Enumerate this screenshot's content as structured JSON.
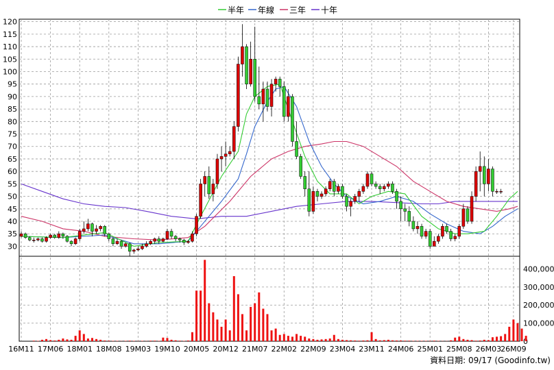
{
  "chart_data": {
    "type": "candlestick",
    "legend": [
      {
        "label": "半年",
        "color": "#33cc33"
      },
      {
        "label": "年線",
        "color": "#3366cc"
      },
      {
        "label": "三年",
        "color": "#cc3366"
      },
      {
        "label": "十年",
        "color": "#6633cc"
      }
    ],
    "price_ticks": [
      30,
      35,
      40,
      45,
      50,
      55,
      60,
      65,
      70,
      75,
      80,
      85,
      90,
      95,
      100,
      105,
      110,
      115,
      120
    ],
    "price_ylim": [
      26,
      121
    ],
    "volume_ticks": [
      {
        "value": 0,
        "label": "0"
      },
      {
        "value": 100000,
        "label": "100,000"
      },
      {
        "value": 200000,
        "label": "200,000"
      },
      {
        "value": 300000,
        "label": "300,000"
      },
      {
        "value": 400000,
        "label": "400,000"
      }
    ],
    "volume_ylim": [
      0,
      470000
    ],
    "x_ticks": [
      {
        "i": 0,
        "label": "16M11"
      },
      {
        "i": 7,
        "label": "17M06"
      },
      {
        "i": 14,
        "label": "18M01"
      },
      {
        "i": 21,
        "label": "18M08"
      },
      {
        "i": 28,
        "label": "19M03"
      },
      {
        "i": 35,
        "label": "19M10"
      },
      {
        "i": 42,
        "label": "20M05"
      },
      {
        "i": 49,
        "label": "20M12"
      },
      {
        "i": 56,
        "label": "21M07"
      },
      {
        "i": 63,
        "label": "22M02"
      },
      {
        "i": 70,
        "label": "22M09"
      },
      {
        "i": 77,
        "label": "23M04"
      },
      {
        "i": 84,
        "label": "23M11"
      },
      {
        "i": 91,
        "label": "24M06"
      },
      {
        "i": 98,
        "label": "25M01"
      },
      {
        "i": 105,
        "label": "25M08"
      },
      {
        "i": 112,
        "label": "26M03"
      },
      {
        "i": 118,
        "label": "26M09"
      }
    ],
    "x_count": 120,
    "candles": [
      [
        34,
        35,
        36,
        33.5
      ],
      [
        35,
        33.5,
        35.5,
        33
      ],
      [
        33.5,
        32.5,
        34,
        32
      ],
      [
        32.5,
        32.5,
        33.5,
        31.5
      ],
      [
        32.5,
        33,
        33.5,
        32
      ],
      [
        33,
        32,
        33.5,
        31.5
      ],
      [
        32,
        33.5,
        34,
        31.5
      ],
      [
        33.5,
        34.5,
        35,
        33
      ],
      [
        34.5,
        33.5,
        35,
        33
      ],
      [
        33.5,
        35,
        36,
        33
      ],
      [
        35,
        34,
        35.5,
        33
      ],
      [
        34,
        32,
        34.5,
        31.5
      ],
      [
        32,
        31,
        32.5,
        30
      ],
      [
        31,
        33,
        33.5,
        30.5
      ],
      [
        33,
        36,
        37,
        32
      ],
      [
        36,
        37,
        40,
        35
      ],
      [
        37,
        39,
        41,
        36
      ],
      [
        39,
        36,
        39.5,
        34
      ],
      [
        36,
        37,
        38.5,
        35
      ],
      [
        37,
        38,
        38.5,
        36
      ],
      [
        38,
        35,
        38.5,
        34
      ],
      [
        35,
        33,
        35.5,
        32
      ],
      [
        33,
        31,
        33.5,
        30
      ],
      [
        31,
        32,
        33,
        30.5
      ],
      [
        32,
        30,
        32.5,
        29
      ],
      [
        30,
        31,
        31.5,
        29.5
      ],
      [
        31,
        28,
        31.5,
        26
      ],
      [
        28,
        28.5,
        29,
        27
      ],
      [
        28.5,
        29,
        30,
        28
      ],
      [
        29,
        30,
        31,
        28.5
      ],
      [
        30,
        31,
        32,
        29.5
      ],
      [
        31,
        32,
        32.5,
        30.5
      ],
      [
        32,
        33,
        33.5,
        31
      ],
      [
        33,
        32,
        34,
        31
      ],
      [
        32,
        33,
        33.5,
        31.5
      ],
      [
        33,
        36,
        37,
        32.5
      ],
      [
        36,
        34,
        37,
        33
      ],
      [
        34,
        33,
        34.5,
        32
      ],
      [
        33,
        32.5,
        33.5,
        31.5
      ],
      [
        32.5,
        31.5,
        33,
        30.5
      ],
      [
        31.5,
        32,
        32.5,
        31
      ],
      [
        32,
        35,
        36,
        31.5
      ],
      [
        35,
        42,
        43,
        34
      ],
      [
        42,
        55,
        57,
        41
      ],
      [
        55,
        58,
        60,
        50
      ],
      [
        58,
        51,
        62,
        49
      ],
      [
        51,
        55,
        57,
        48
      ],
      [
        55,
        65,
        67,
        53
      ],
      [
        65,
        66,
        70,
        60
      ],
      [
        66,
        67,
        72,
        62
      ],
      [
        67,
        68,
        70,
        66
      ],
      [
        68,
        78,
        80,
        65
      ],
      [
        78,
        103,
        106,
        76
      ],
      [
        103,
        110,
        119,
        98
      ],
      [
        110,
        95,
        111,
        93
      ],
      [
        95,
        105,
        112,
        94
      ],
      [
        105,
        90,
        118,
        88
      ],
      [
        90,
        87,
        102,
        85
      ],
      [
        87,
        93,
        96,
        80
      ],
      [
        93,
        86,
        96,
        84
      ],
      [
        86,
        95,
        97,
        82
      ],
      [
        95,
        97,
        98,
        92
      ],
      [
        97,
        94,
        98,
        90
      ],
      [
        94,
        82,
        96,
        80
      ],
      [
        82,
        90,
        93,
        80
      ],
      [
        90,
        72,
        91,
        70
      ],
      [
        72,
        66,
        80,
        65
      ],
      [
        66,
        58,
        67,
        57
      ],
      [
        58,
        53,
        60,
        50
      ],
      [
        53,
        44,
        60,
        42
      ],
      [
        44,
        52,
        54,
        43
      ],
      [
        52,
        50,
        53,
        48
      ],
      [
        50,
        51,
        52,
        49
      ],
      [
        51,
        53,
        54,
        50
      ],
      [
        53,
        56,
        57,
        52
      ],
      [
        56,
        52,
        57,
        50
      ],
      [
        52,
        54,
        55,
        51
      ],
      [
        54,
        50,
        55,
        49
      ],
      [
        50,
        46,
        51,
        44
      ],
      [
        46,
        48,
        49,
        42
      ],
      [
        48,
        50,
        51,
        47
      ],
      [
        50,
        52,
        53,
        48
      ],
      [
        52,
        54,
        55,
        51
      ],
      [
        54,
        59,
        60,
        53
      ],
      [
        59,
        55,
        60,
        54
      ],
      [
        55,
        54,
        56,
        53
      ],
      [
        54,
        53,
        55,
        51
      ],
      [
        53,
        54,
        55,
        52
      ],
      [
        54,
        55,
        56,
        53
      ],
      [
        55,
        52,
        56,
        51
      ],
      [
        52,
        48,
        53,
        45
      ],
      [
        48,
        45,
        50,
        40
      ],
      [
        45,
        44,
        47,
        40
      ],
      [
        44,
        40,
        46,
        38
      ],
      [
        40,
        37,
        42,
        36
      ],
      [
        37,
        38,
        40,
        35
      ],
      [
        38,
        34,
        39,
        33
      ],
      [
        34,
        36,
        37,
        33
      ],
      [
        36,
        30,
        37,
        29
      ],
      [
        30,
        32,
        34,
        31
      ],
      [
        32,
        34,
        35,
        31
      ],
      [
        34,
        38,
        39,
        33
      ],
      [
        38,
        36,
        39,
        35
      ],
      [
        36,
        33,
        37,
        32
      ],
      [
        33,
        34,
        35,
        32
      ],
      [
        34,
        38,
        39,
        33
      ],
      [
        38,
        45,
        47,
        37
      ],
      [
        45,
        40,
        46,
        39
      ],
      [
        40,
        50,
        52,
        39
      ],
      [
        50,
        60,
        62,
        48
      ],
      [
        60,
        62,
        68,
        52
      ],
      [
        62,
        55,
        66,
        50
      ],
      [
        55,
        61,
        65,
        52
      ],
      [
        61,
        52,
        62,
        50
      ],
      [
        52,
        52,
        53,
        51
      ],
      [
        52,
        52,
        53,
        51
      ]
    ],
    "volume": [
      0,
      0,
      0,
      3000,
      2000,
      8000,
      12000,
      6000,
      4000,
      8000,
      15000,
      10000,
      8000,
      30000,
      60000,
      40000,
      15000,
      18000,
      12000,
      8000,
      4000,
      3000,
      2000,
      2000,
      1000,
      2000,
      3000,
      2000,
      1000,
      2000,
      1000,
      3000,
      3000,
      2000,
      20000,
      18000,
      8000,
      5000,
      3000,
      2000,
      4000,
      50000,
      280000,
      280000,
      450000,
      210000,
      160000,
      120000,
      80000,
      120000,
      60000,
      360000,
      260000,
      150000,
      60000,
      190000,
      210000,
      270000,
      180000,
      150000,
      60000,
      70000,
      35000,
      40000,
      30000,
      25000,
      40000,
      30000,
      25000,
      15000,
      12000,
      8000,
      10000,
      12000,
      15000,
      35000,
      12000,
      8000,
      6000,
      5000,
      4000,
      3000,
      4000,
      5000,
      50000,
      12000,
      5000,
      6000,
      8000,
      5000,
      4000,
      4000,
      3000,
      3000,
      2000,
      2000,
      2000,
      2000,
      2000,
      3000,
      2000,
      1000,
      1000,
      5000,
      20000,
      25000,
      12000,
      8000,
      6000,
      3000,
      4000,
      8000,
      6000,
      22000,
      25000,
      28000,
      40000,
      80000,
      120000,
      100000,
      70000,
      30000
    ],
    "ma_half": [
      [
        0,
        34
      ],
      [
        10,
        33.5
      ],
      [
        20,
        35.5
      ],
      [
        27,
        30
      ],
      [
        33,
        31.5
      ],
      [
        40,
        32
      ],
      [
        43,
        42
      ],
      [
        48,
        58
      ],
      [
        52,
        68
      ],
      [
        54,
        83
      ],
      [
        56,
        90
      ],
      [
        59,
        94
      ],
      [
        62,
        95
      ],
      [
        65,
        80
      ],
      [
        68,
        66
      ],
      [
        71,
        56
      ],
      [
        74,
        51
      ],
      [
        78,
        51
      ],
      [
        81,
        47
      ],
      [
        84,
        50
      ],
      [
        88,
        52
      ],
      [
        92,
        51
      ],
      [
        96,
        42
      ],
      [
        100,
        37
      ],
      [
        104,
        35
      ],
      [
        107,
        35
      ],
      [
        111,
        36
      ],
      [
        114,
        42
      ],
      [
        117,
        49
      ],
      [
        119,
        52
      ]
    ],
    "ma_year": [
      [
        0,
        34
      ],
      [
        10,
        33.5
      ],
      [
        20,
        34.5
      ],
      [
        27,
        31
      ],
      [
        33,
        31
      ],
      [
        40,
        32
      ],
      [
        43,
        38
      ],
      [
        48,
        48
      ],
      [
        52,
        57
      ],
      [
        54,
        67
      ],
      [
        56,
        78
      ],
      [
        59,
        88
      ],
      [
        61,
        93
      ],
      [
        63,
        94
      ],
      [
        66,
        86
      ],
      [
        69,
        72
      ],
      [
        72,
        62
      ],
      [
        75,
        55
      ],
      [
        78,
        50
      ],
      [
        82,
        47
      ],
      [
        86,
        48
      ],
      [
        90,
        50
      ],
      [
        94,
        48
      ],
      [
        98,
        43
      ],
      [
        102,
        39
      ],
      [
        106,
        36
      ],
      [
        110,
        35
      ],
      [
        113,
        38
      ],
      [
        116,
        42
      ],
      [
        119,
        45
      ]
    ],
    "ma_3y": [
      [
        0,
        42
      ],
      [
        5,
        40
      ],
      [
        10,
        37
      ],
      [
        15,
        36
      ],
      [
        20,
        34
      ],
      [
        27,
        33
      ],
      [
        33,
        32.5
      ],
      [
        40,
        33.5
      ],
      [
        44,
        38
      ],
      [
        50,
        48
      ],
      [
        55,
        58
      ],
      [
        60,
        65
      ],
      [
        64,
        68
      ],
      [
        68,
        70
      ],
      [
        72,
        71
      ],
      [
        75,
        72
      ],
      [
        78,
        72
      ],
      [
        82,
        70
      ],
      [
        86,
        66
      ],
      [
        90,
        62
      ],
      [
        94,
        56
      ],
      [
        98,
        52
      ],
      [
        102,
        48
      ],
      [
        106,
        46
      ],
      [
        110,
        45
      ],
      [
        114,
        44
      ],
      [
        117,
        45
      ],
      [
        119,
        46
      ]
    ],
    "ma_10y": [
      [
        0,
        55
      ],
      [
        5,
        52
      ],
      [
        10,
        49
      ],
      [
        15,
        47
      ],
      [
        20,
        46
      ],
      [
        25,
        45.5
      ],
      [
        30,
        44
      ],
      [
        36,
        42
      ],
      [
        42,
        41
      ],
      [
        48,
        42
      ],
      [
        54,
        42
      ],
      [
        60,
        44
      ],
      [
        66,
        46
      ],
      [
        72,
        47
      ],
      [
        78,
        48
      ],
      [
        84,
        48
      ],
      [
        90,
        47.5
      ],
      [
        96,
        47
      ],
      [
        100,
        47
      ],
      [
        104,
        48
      ],
      [
        108,
        48
      ],
      [
        112,
        48
      ],
      [
        116,
        48
      ],
      [
        119,
        48
      ]
    ],
    "footer": "資料日期: 09/17  (Goodinfo.tw)"
  }
}
